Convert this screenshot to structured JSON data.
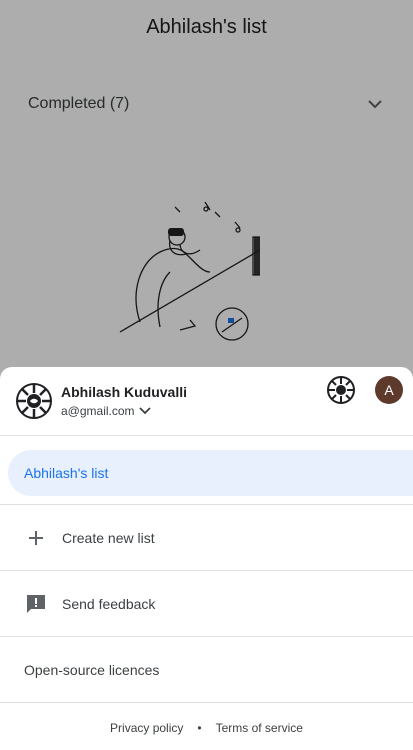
{
  "app": {
    "list_title": "Abhilash's list",
    "completed_label": "Completed (7)"
  },
  "account": {
    "name": "Abhilash Kuduvalli",
    "email": "a@gmail.com",
    "alt_avatar_letter": "A",
    "alt_avatar_color": "#5d3a2c"
  },
  "lists": {
    "active": "Abhilash's list",
    "active_color": "#1a73e8",
    "active_bg": "#e8f0fe"
  },
  "menu": {
    "create_new_list": "Create new list",
    "send_feedback": "Send feedback",
    "open_source": "Open-source licences"
  },
  "footer": {
    "privacy": "Privacy policy",
    "separator": "•",
    "terms": "Terms of service"
  }
}
